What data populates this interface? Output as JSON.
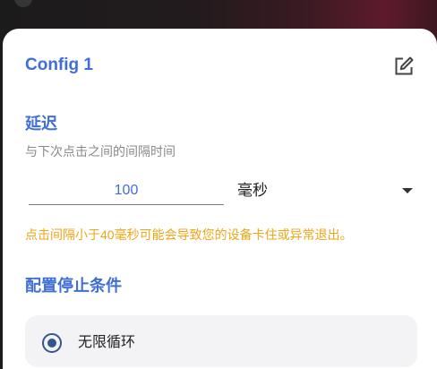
{
  "dialog": {
    "title": "Config 1",
    "edit_icon": "edit-icon"
  },
  "delay": {
    "heading": "延迟",
    "description": "与下次点击之间的间隔时间",
    "value": "100",
    "unit": "毫秒",
    "dropdown_icon": "dropdown-arrow-icon",
    "warning": "点击间隔小于40毫秒可能会导致您的设备卡住或异常退出。"
  },
  "stop_condition": {
    "heading": "配置停止条件",
    "options": [
      {
        "label": "无限循环",
        "selected": true
      }
    ]
  },
  "colors": {
    "accent": "#3f6fd4",
    "radio": "#34568f",
    "warning": "#f2a516"
  }
}
